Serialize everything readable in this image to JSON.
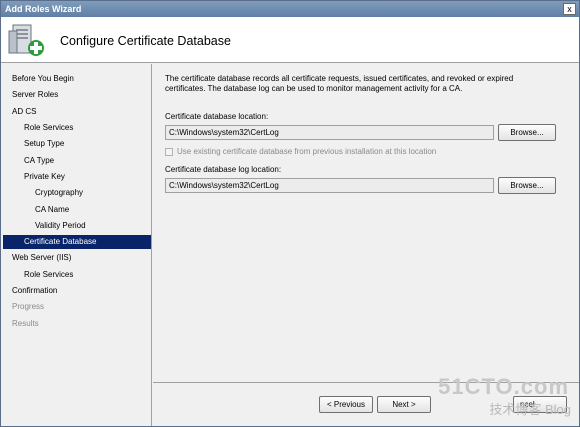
{
  "window": {
    "title": "Add Roles Wizard",
    "close_label": "x"
  },
  "header": {
    "title": "Configure Certificate Database"
  },
  "sidebar": {
    "items": [
      {
        "label": "Before You Begin",
        "state": "normal"
      },
      {
        "label": "Server Roles",
        "state": "normal"
      },
      {
        "label": "AD CS",
        "state": "normal"
      },
      {
        "label": "Role Services",
        "state": "normal"
      },
      {
        "label": "Setup Type",
        "state": "normal"
      },
      {
        "label": "CA Type",
        "state": "normal"
      },
      {
        "label": "Private Key",
        "state": "normal"
      },
      {
        "label": "Cryptography",
        "state": "normal"
      },
      {
        "label": "CA Name",
        "state": "normal"
      },
      {
        "label": "Validity Period",
        "state": "normal"
      },
      {
        "label": "Certificate Database",
        "state": "selected"
      },
      {
        "label": "Web Server (IIS)",
        "state": "normal"
      },
      {
        "label": "Role Services",
        "state": "normal"
      },
      {
        "label": "Confirmation",
        "state": "normal"
      },
      {
        "label": "Progress",
        "state": "disabled"
      },
      {
        "label": "Results",
        "state": "disabled"
      }
    ]
  },
  "main": {
    "description": "The certificate database records all certificate requests, issued certificates, and revoked or expired certificates. The database log can be used to monitor management activity for a CA.",
    "db_location_label": "Certificate database location:",
    "db_location_value": "C:\\Windows\\system32\\CertLog",
    "browse_label": "Browse...",
    "use_existing_label": "Use existing certificate database from previous installation at this location",
    "use_existing_checked": false,
    "log_location_label": "Certificate database log location:",
    "log_location_value": "C:\\Windows\\system32\\CertLog"
  },
  "footer": {
    "previous_label": "< Previous",
    "next_label": "Next >",
    "cancel_label": "ncel"
  },
  "watermark": {
    "main": "51CTO.com",
    "sub": "技术博客  Blog"
  },
  "colors": {
    "selection": "#0a246a",
    "titlebar": "#5f7fa6"
  }
}
